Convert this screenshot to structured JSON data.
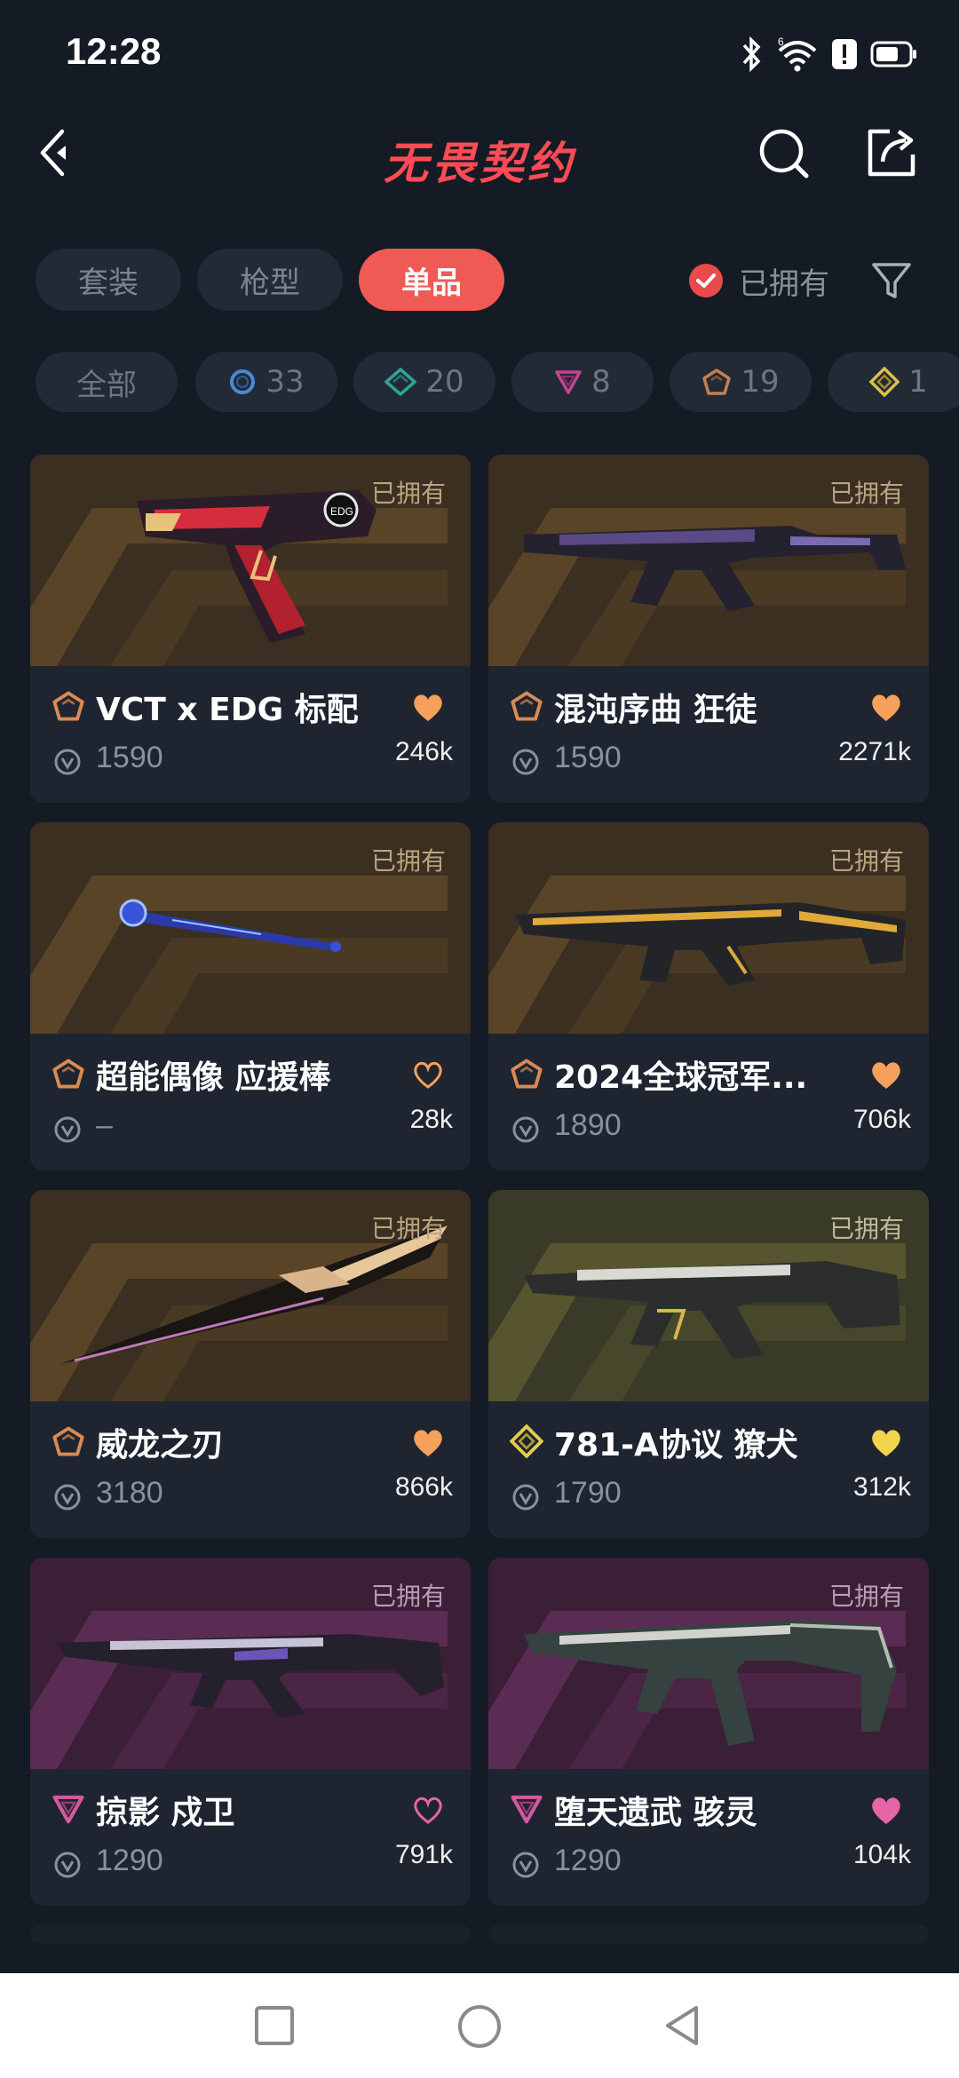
{
  "status_bar": {
    "time": "12:28"
  },
  "header": {
    "title": "无畏契约"
  },
  "tabs": [
    {
      "label": "套装",
      "active": false
    },
    {
      "label": "枪型",
      "active": false
    },
    {
      "label": "单品",
      "active": true
    }
  ],
  "owned_filter": {
    "label": "已拥有",
    "checked": true
  },
  "tier_chips": [
    {
      "label": "全部",
      "icon": ""
    },
    {
      "label": "33",
      "icon": "select-tier-icon"
    },
    {
      "label": "20",
      "icon": "deluxe-tier-icon"
    },
    {
      "label": "8",
      "icon": "premium-tier-icon"
    },
    {
      "label": "19",
      "icon": "exclusive-tier-icon"
    },
    {
      "label": "1",
      "icon": "ultra-tier-icon"
    }
  ],
  "skins": [
    {
      "name": "VCT x EDG 标配",
      "price": "1590",
      "likes": "246k",
      "owned_label": "已拥有",
      "tier": "exclusive",
      "liked": true
    },
    {
      "name": "混沌序曲 狂徒",
      "price": "1590",
      "likes": "2271k",
      "owned_label": "已拥有",
      "tier": "exclusive",
      "liked": true
    },
    {
      "name": "超能偶像 应援棒",
      "price": "–",
      "likes": "28k",
      "owned_label": "已拥有",
      "tier": "exclusive",
      "liked": false
    },
    {
      "name": "2024全球冠军...",
      "price": "1890",
      "likes": "706k",
      "owned_label": "已拥有",
      "tier": "exclusive",
      "liked": true
    },
    {
      "name": "威龙之刃",
      "price": "3180",
      "likes": "866k",
      "owned_label": "已拥有",
      "tier": "exclusive",
      "liked": true
    },
    {
      "name": "781-A协议 獠犬",
      "price": "1790",
      "likes": "312k",
      "owned_label": "已拥有",
      "tier": "ultra",
      "liked": true
    },
    {
      "name": "掠影 戍卫",
      "price": "1290",
      "likes": "791k",
      "owned_label": "已拥有",
      "tier": "premium",
      "liked": false
    },
    {
      "name": "堕天遗武 骇灵",
      "price": "1290",
      "likes": "104k",
      "owned_label": "已拥有",
      "tier": "premium",
      "liked": true
    }
  ],
  "colors": {
    "accent": "#ef5a55",
    "exclusive_heart": "#f5a15b",
    "ultra_heart": "#f2d44f",
    "premium_heart": "#e565a8",
    "background": "#151b24"
  }
}
